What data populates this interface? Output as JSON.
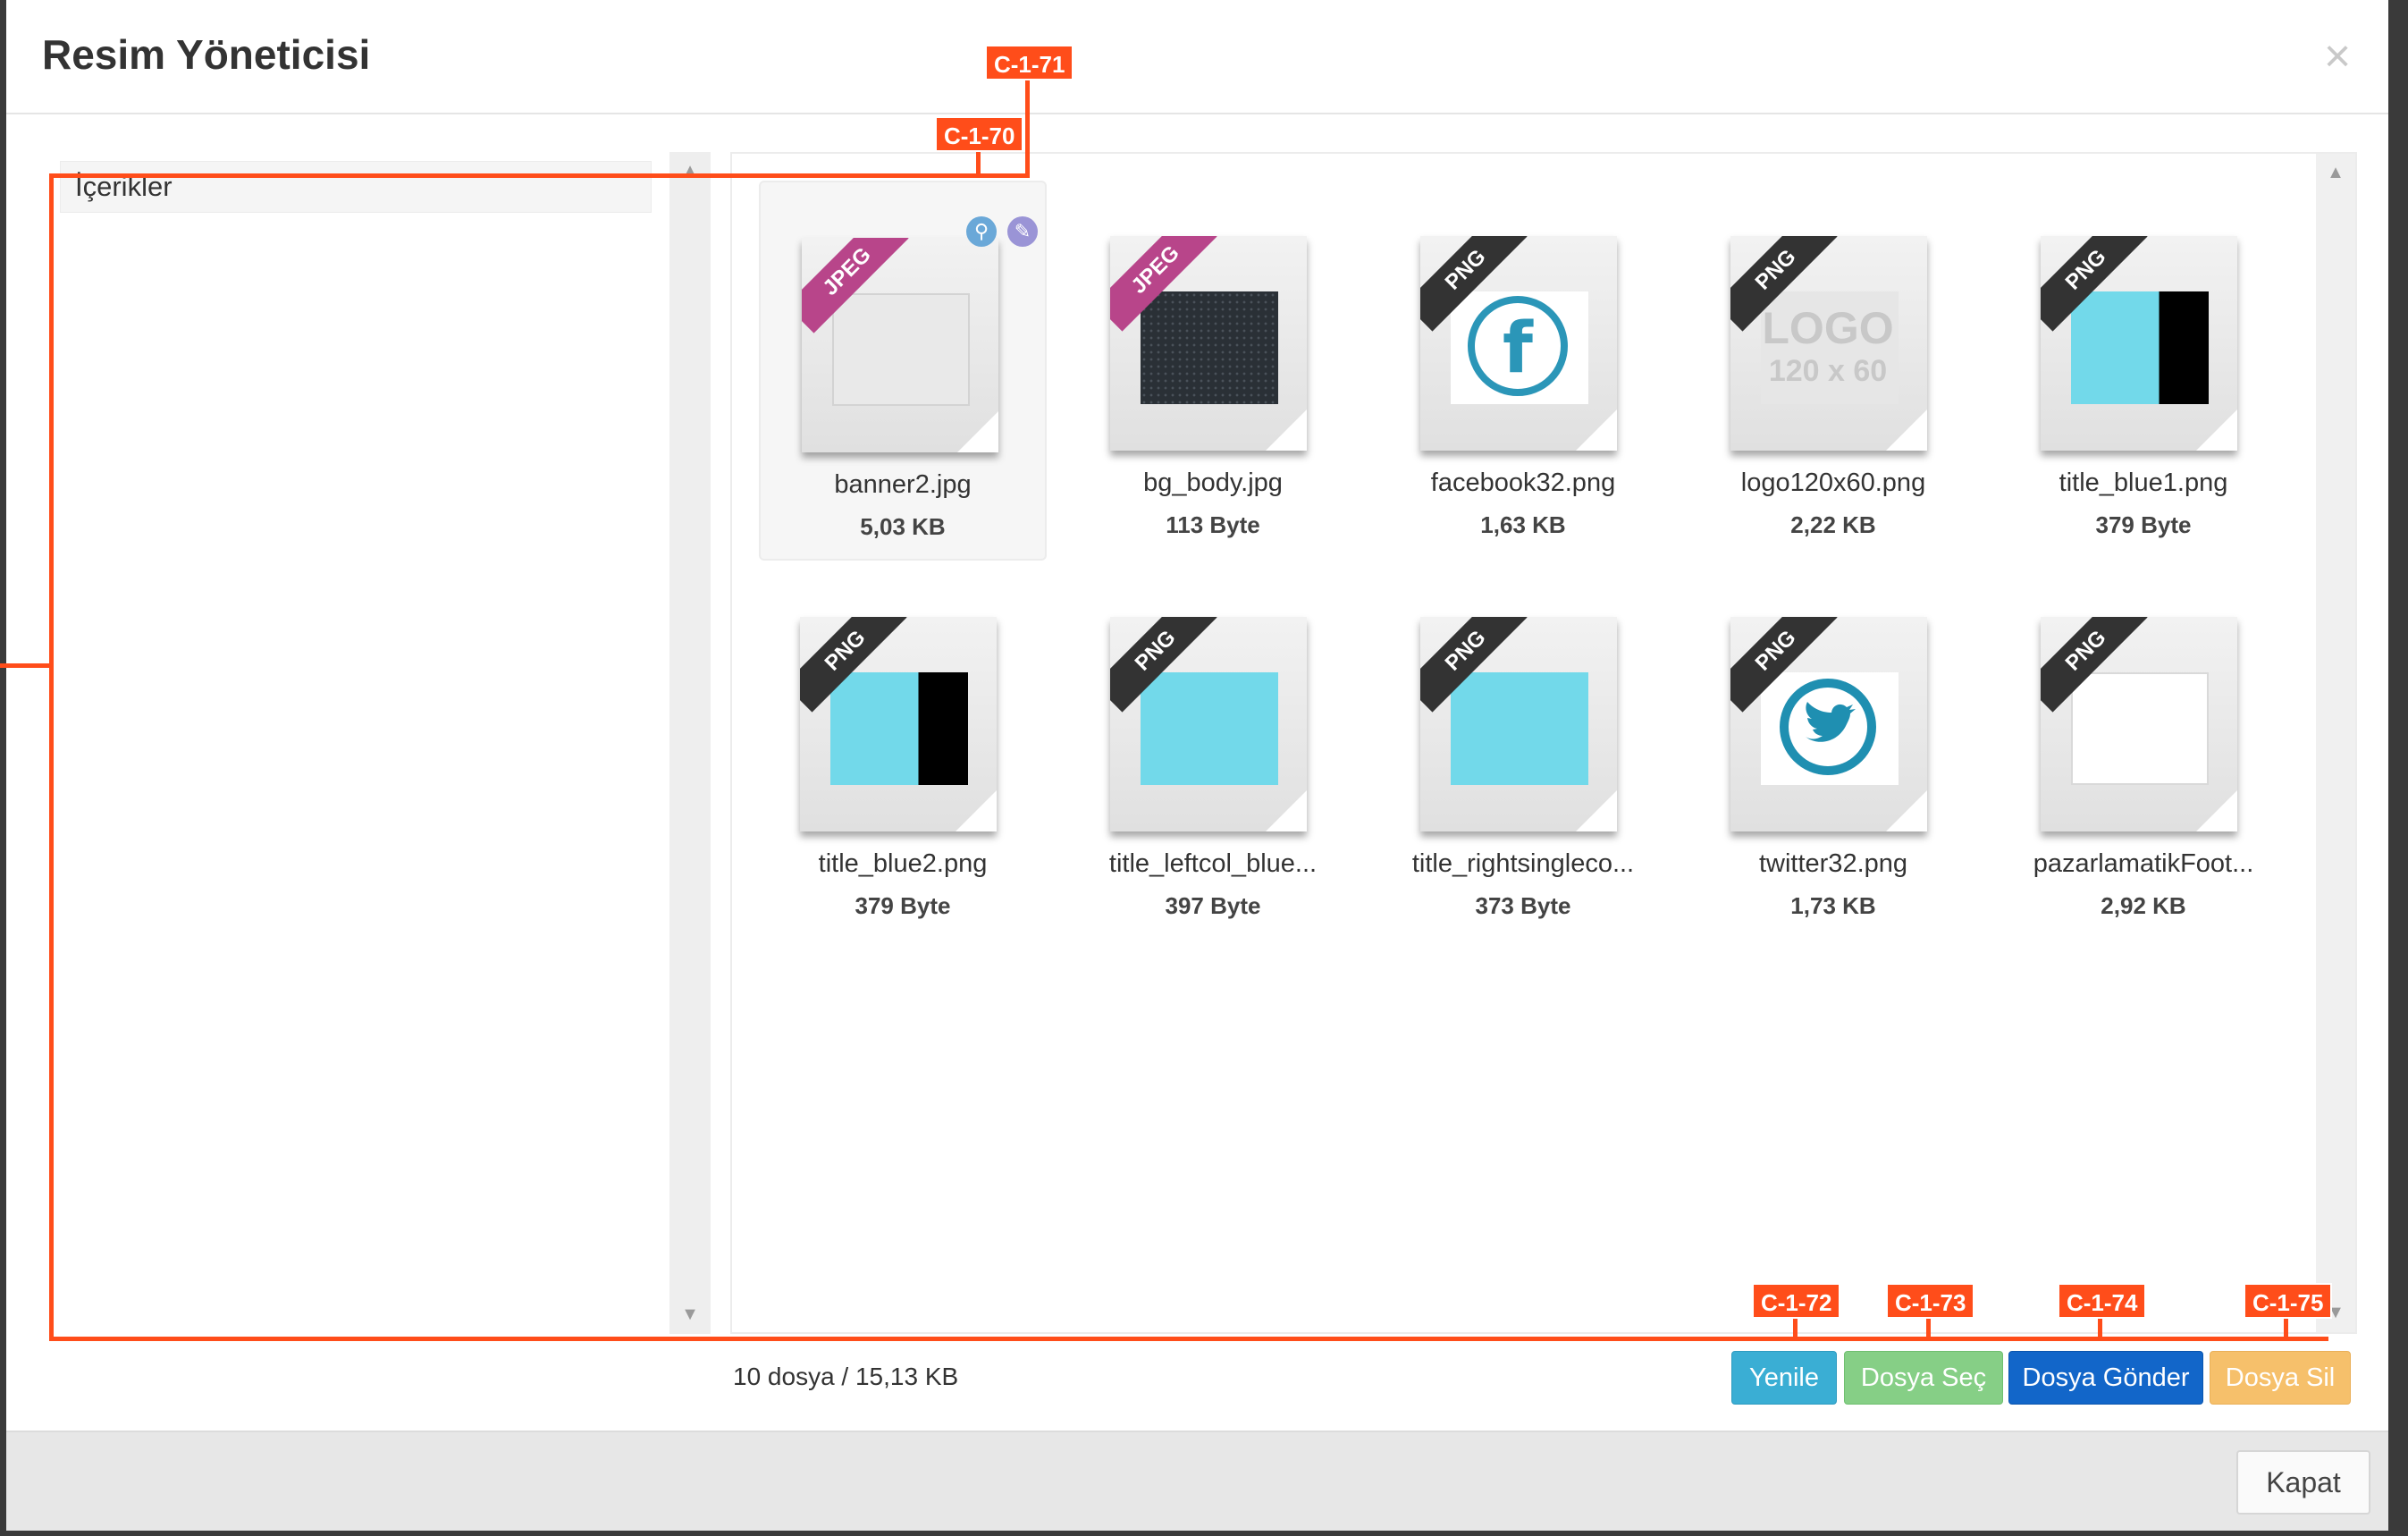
{
  "dialog": {
    "title": "Resim Yöneticisi",
    "close_symbol": "×"
  },
  "tree": {
    "items": [
      {
        "label": "İçerikler"
      }
    ]
  },
  "files": [
    {
      "name": "banner2.jpg",
      "size": "5,03 KB",
      "type": "JPEG",
      "thumb": "placeholder-image",
      "selected": true
    },
    {
      "name": "bg_body.jpg",
      "size": "113 Byte",
      "type": "JPEG",
      "thumb": "dark-pattern"
    },
    {
      "name": "facebook32.png",
      "size": "1,63 KB",
      "type": "PNG",
      "thumb": "facebook-logo"
    },
    {
      "name": "logo120x60.png",
      "size": "2,22 KB",
      "type": "PNG",
      "thumb": "logo-placeholder"
    },
    {
      "name": "title_blue1.png",
      "size": "379 Byte",
      "type": "PNG",
      "thumb": "cyan-black"
    },
    {
      "name": "title_blue2.png",
      "size": "379 Byte",
      "type": "PNG",
      "thumb": "cyan-black"
    },
    {
      "name": "title_leftcol_blue...",
      "size": "397 Byte",
      "type": "PNG",
      "thumb": "cyan"
    },
    {
      "name": "title_rightsingleco...",
      "size": "373 Byte",
      "type": "PNG",
      "thumb": "cyan"
    },
    {
      "name": "twitter32.png",
      "size": "1,73 KB",
      "type": "PNG",
      "thumb": "twitter-logo"
    },
    {
      "name": "pazarlamatikFoot...",
      "size": "2,92 KB",
      "type": "PNG",
      "thumb": "white"
    }
  ],
  "footer": {
    "info": "10 dosya / 15,13 KB",
    "buttons": {
      "refresh": "Yenile",
      "select": "Dosya Seç",
      "send": "Dosya Gönder",
      "delete": "Dosya Sil"
    },
    "close": "Kapat"
  },
  "annotations": [
    "C-1-70",
    "C-1-71",
    "C-1-72",
    "C-1-73",
    "C-1-74",
    "C-1-75"
  ],
  "colors": {
    "jpeg_ribbon": "#b8458a",
    "png_ribbon": "#333333",
    "accent_annotation": "#ff4d1a",
    "cyan": "#72d9ea"
  }
}
